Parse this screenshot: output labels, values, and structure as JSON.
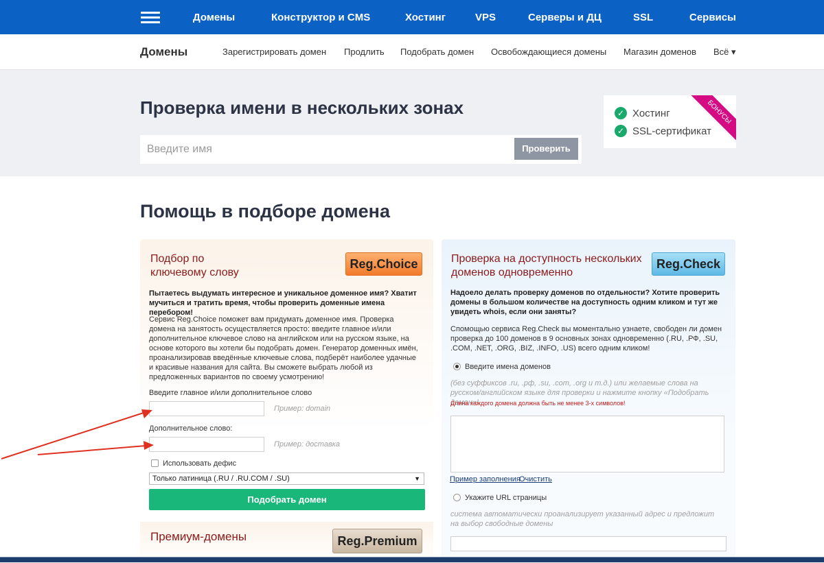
{
  "topnav": {
    "items": [
      "Домены",
      "Конструктор и CMS",
      "Хостинг",
      "VPS",
      "Серверы и ДЦ",
      "SSL",
      "Сервисы"
    ]
  },
  "subnav": {
    "title": "Домены",
    "links": [
      "Зарегистрировать домен",
      "Продлить",
      "Подобрать домен",
      "Освобождающиеся домены",
      "Магазин доменов",
      "Всё ▾"
    ]
  },
  "hero": {
    "title": "Проверка имени в нескольких зонах",
    "search_placeholder": "Введите имя",
    "check_button": "Проверить",
    "bonus": {
      "ribbon": "БОНУСЫ",
      "items": [
        "Хостинг",
        "SSL-сертификат"
      ]
    }
  },
  "section_title": "Помощь в подборе домена",
  "regchoice": {
    "title": "Подбор по ключевому слову",
    "logo": "Reg.Choice",
    "intro": "Пытаетесь выдумать интересное и уникальное доменное имя? Хватит мучиться и тратить время, чтобы проверить доменные имена перебором!",
    "description": "Сервис Reg.Choice поможет вам придумать доменное имя. Проверка домена на занятость осуществляется просто: введите главное и/или дополнительное ключевое слово на английском или на русском языке, на основе которого вы хотели бы подобрать домен. Генератор доменных имён, проанализировав введённые ключевые слова, подберёт наиболее удачные и красивые названия для сайта. Вы сможете выбрать любой из предложенных вариантов по своему усмотрению!",
    "main_label": "Введите главное и/или дополнительное слово",
    "main_example": "Пример: domain",
    "extra_label": "Дополнительное слово:",
    "extra_example": "Пример: доставка",
    "hyphen_label": "Использовать дефис",
    "select_value": "Только латиница (.RU / .RU.COM / .SU)",
    "submit": "Подобрать домен"
  },
  "premium": {
    "title": "Премиум-домены",
    "logo": "Reg.Premium"
  },
  "regcheck": {
    "title": "Проверка на доступность нескольких доменов одновременно",
    "logo": "Reg.Check",
    "intro": "Надоело делать проверку доменов по отдельности? Хотите проверить домены в большом количестве на доступность одним кликом и тут же увидеть whois, если они заняты?",
    "description": "Спомощью сервиса Reg.Check вы моментально узнаете, свободен ли домен проверка до 100 доменов в 9 основных зонах одновременно (.RU, .РФ, .SU, .COM, .NET, .ORG, .BIZ, .INFO, .US) всего одним кликом!",
    "radio_names": "Введите имена доменов",
    "names_hint": "(без суффиксов .ru, .рф, .su, .com, .org и т.д.) или желаемые слова на русском/английском языке для проверки и нажмите кнопку «Подобрать домен»!",
    "min_length": "Длина каждого домена должна быть не менее 3-х символов!",
    "example_link": "Пример заполнения",
    "clear_link": "Очистить",
    "radio_url": "Укажите URL страницы",
    "url_hint": "система автоматически проанализирует указанный адрес и предложит на выбор свободные домены"
  }
}
